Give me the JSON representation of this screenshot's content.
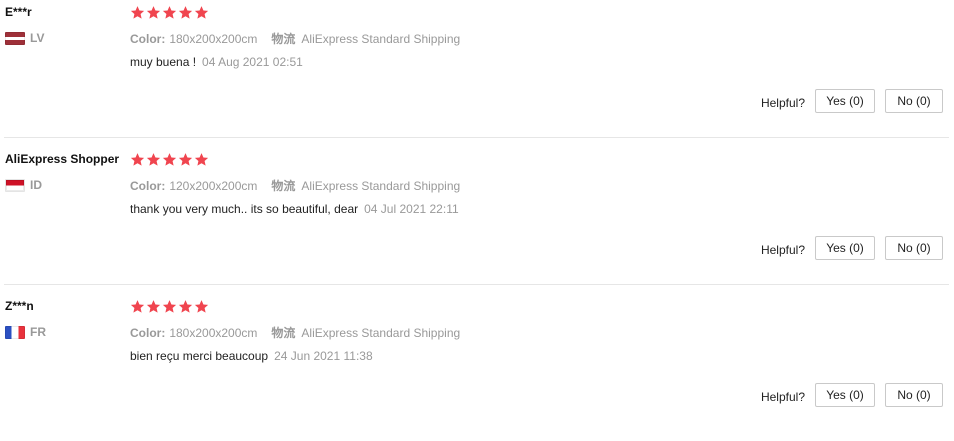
{
  "reviews": [
    {
      "user": "E***r",
      "country": "LV",
      "rating": 5,
      "color_label": "Color:",
      "color_value": "180x200x200cm",
      "shipping_label": "物流",
      "shipping_value": "AliExpress Standard Shipping",
      "text": "muy buena !",
      "date": "04 Aug 2021 02:51",
      "helpful_label": "Helpful?",
      "yes_label": "Yes (0)",
      "no_label": "No (0)"
    },
    {
      "user": "AliExpress Shopper",
      "country": "ID",
      "rating": 5,
      "color_label": "Color:",
      "color_value": "120x200x200cm",
      "shipping_label": "物流",
      "shipping_value": "AliExpress Standard Shipping",
      "text": "thank you very much.. its so beautiful, dear",
      "date": "04 Jul 2021 22:11",
      "helpful_label": "Helpful?",
      "yes_label": "Yes (0)",
      "no_label": "No (0)"
    },
    {
      "user": "Z***n",
      "country": "FR",
      "rating": 5,
      "color_label": "Color:",
      "color_value": "180x200x200cm",
      "shipping_label": "物流",
      "shipping_value": "AliExpress Standard Shipping",
      "text": "bien reçu merci beaucoup",
      "date": "24 Jun 2021 11:38",
      "helpful_label": "Helpful?",
      "yes_label": "Yes (0)",
      "no_label": "No (0)"
    }
  ],
  "colors": {
    "star": "#f0454f",
    "muted": "#999999",
    "text": "#222222",
    "divider": "#e6e6e6"
  },
  "icons": {
    "star": "star-icon",
    "flag": "country-flag-icon"
  }
}
